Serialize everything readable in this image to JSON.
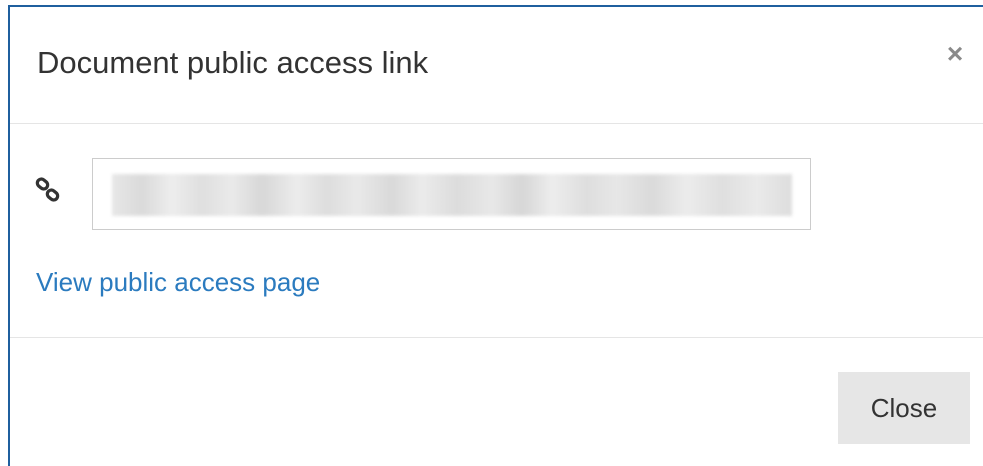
{
  "dialog": {
    "title": "Document public access link",
    "close_icon": "close-icon",
    "close_glyph": "×"
  },
  "body": {
    "link_icon": "link-icon",
    "url_value": "",
    "view_link_label": "View public access page"
  },
  "footer": {
    "close_label": "Close"
  },
  "colors": {
    "accent_border": "#1f5f9e",
    "link": "#2b7bbf",
    "button_bg": "#e6e6e6"
  }
}
